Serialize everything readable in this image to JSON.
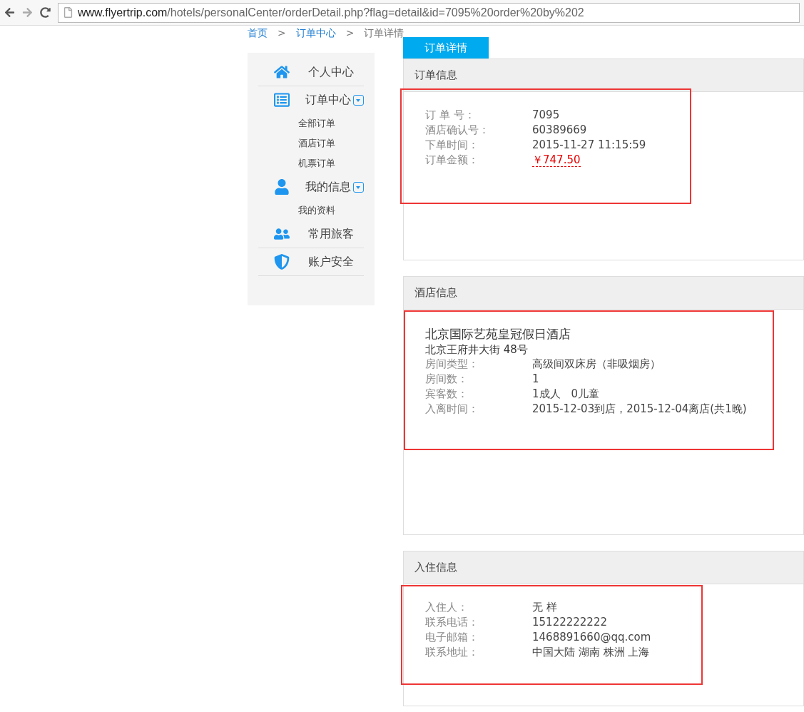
{
  "browser": {
    "url_host": "www.flyertrip.com",
    "url_path": "/hotels/personalCenter/orderDetail.php?flag=detail&id=7095%20order%20by%202"
  },
  "breadcrumb": [
    {
      "label": "首页",
      "link": true
    },
    {
      "label": ">",
      "link": false
    },
    {
      "label": "订单中心",
      "link": true
    },
    {
      "label": ">",
      "link": false
    },
    {
      "label": "订单详情",
      "link": false
    }
  ],
  "sidebar": {
    "items": [
      {
        "label": "个人中心",
        "expandable": false
      },
      {
        "label": "订单中心",
        "expandable": true,
        "children": [
          "全部订单",
          "酒店订单",
          "机票订单"
        ]
      },
      {
        "label": "我的信息",
        "expandable": true,
        "children": [
          "我的资料"
        ]
      },
      {
        "label": "常用旅客",
        "expandable": false
      },
      {
        "label": "账户安全",
        "expandable": false
      }
    ]
  },
  "tab": {
    "label": "订单详情",
    "selected": true
  },
  "sections": [
    {
      "title": "订单信息",
      "highlighted": true,
      "fields": [
        {
          "label": "订 单 号：",
          "value": "7095",
          "kind": "plain"
        },
        {
          "label": "酒店确认号：",
          "value": "60389669",
          "kind": "plain"
        },
        {
          "label": "下单时间：",
          "value": "2015-11-27 11:15:59",
          "kind": "plain"
        },
        {
          "label": "订单金额：",
          "value": "￥747.50",
          "kind": "price"
        }
      ]
    },
    {
      "title": "酒店信息",
      "highlighted": true,
      "hotel_name": "北京国际艺苑皇冠假日酒店",
      "hotel_address": "北京王府井大街 48号",
      "fields": [
        {
          "label": "房间类型：",
          "value": "高级间双床房（非吸烟房）",
          "kind": "plain"
        },
        {
          "label": "房间数：",
          "value": "1",
          "kind": "plain"
        },
        {
          "label": "宾客数：",
          "value": "1成人　0儿童",
          "kind": "plain"
        },
        {
          "label": "入离时间：",
          "value": "2015-12-03到店，2015-12-04离店(共1晚)",
          "kind": "plain"
        }
      ]
    },
    {
      "title": "入住信息",
      "highlighted": true,
      "fields": [
        {
          "label": "入住人：",
          "value": "无 样",
          "kind": "plain"
        },
        {
          "label": "联系电话：",
          "value": "15122222222",
          "kind": "plain"
        },
        {
          "label": "电子邮箱：",
          "value": "1468891660@qq.com",
          "kind": "plain"
        },
        {
          "label": "联系地址：",
          "value": "中国大陆 湖南 株洲 上海",
          "kind": "plain"
        }
      ]
    }
  ]
}
